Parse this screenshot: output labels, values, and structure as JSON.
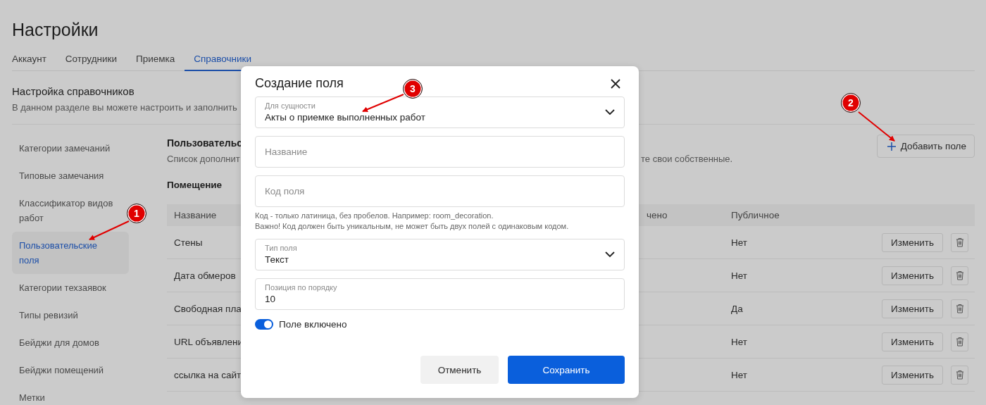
{
  "page_title": "Настройки",
  "tabs": [
    {
      "label": "Аккаунт",
      "selected": false
    },
    {
      "label": "Сотрудники",
      "selected": false
    },
    {
      "label": "Приемка",
      "selected": false
    },
    {
      "label": "Справочники",
      "selected": true
    }
  ],
  "section": {
    "title": "Настройка справочников",
    "description": "В данном разделе вы можете настроить и заполнить"
  },
  "sidebar": {
    "items": [
      {
        "label": "Категории замечаний",
        "selected": false
      },
      {
        "label": "Типовые замечания",
        "selected": false
      },
      {
        "label": "Классификатор видов работ",
        "selected": false
      },
      {
        "label": "Пользовательские поля",
        "selected": true
      },
      {
        "label": "Категории техзаявок",
        "selected": false
      },
      {
        "label": "Типы ревизий",
        "selected": false
      },
      {
        "label": "Бейджи для домов",
        "selected": false
      },
      {
        "label": "Бейджи помещений",
        "selected": false
      },
      {
        "label": "Метки",
        "selected": false
      }
    ]
  },
  "content": {
    "title": "Пользовательс",
    "description_left": "Список дополнит",
    "description_right": "те свои собственные.",
    "add_button": "Добавить поле",
    "group_title": "Помещение",
    "table": {
      "columns": [
        "Название",
        "чено",
        "Публичное"
      ],
      "rows": [
        {
          "name": "Стены",
          "public": "Нет",
          "edit_button": "Изменить"
        },
        {
          "name": "Дата обмеров",
          "public": "Нет",
          "edit_button": "Изменить"
        },
        {
          "name": "Свободная пла",
          "public": "Да",
          "edit_button": "Изменить"
        },
        {
          "name": "URL объявлени",
          "public": "Нет",
          "edit_button": "Изменить"
        },
        {
          "name": "ссылка на сайт",
          "public": "Нет",
          "edit_button": "Изменить"
        }
      ]
    }
  },
  "dialog": {
    "title": "Создание поля",
    "fields": [
      {
        "kind": "select",
        "label": "Для сущности",
        "value": "Акты о приемке выполненных работ"
      },
      {
        "kind": "text",
        "placeholder": "Название"
      },
      {
        "kind": "text",
        "placeholder": "Код поля"
      },
      {
        "kind": "hint",
        "lines": [
          "Код - только латиница, без пробелов. Например: room_decoration.",
          "Важно! Код должен быть уникальным, не может быть двух полей с одинаковым кодом."
        ]
      },
      {
        "kind": "select",
        "label": "Тип поля",
        "value": "Текст"
      },
      {
        "kind": "labeled",
        "label": "Позиция по порядку",
        "value": "10"
      }
    ],
    "toggle": {
      "label": "Поле включено",
      "on": true
    },
    "buttons": [
      {
        "label": "Отменить",
        "kind": "secondary"
      },
      {
        "label": "Сохранить",
        "kind": "primary"
      }
    ]
  },
  "annotations": [
    {
      "label": "1"
    },
    {
      "label": "2"
    },
    {
      "label": "3"
    }
  ]
}
